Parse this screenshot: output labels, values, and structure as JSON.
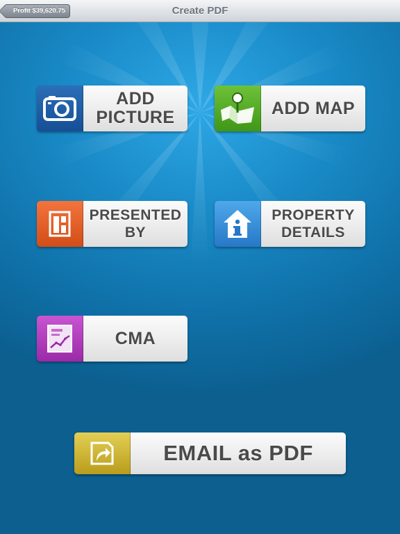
{
  "navbar": {
    "title": "Create PDF",
    "back_label": "Profit $39,620.75"
  },
  "tiles": {
    "add_picture": {
      "label": "ADD\nPICTURE",
      "icon": "camera-icon",
      "color": "#1d5fa8"
    },
    "add_map": {
      "label": "ADD MAP",
      "icon": "map-pin-icon",
      "color": "#52aa24"
    },
    "presented_by": {
      "label": "PRESENTED\nBY",
      "icon": "agent-card-icon",
      "color": "#e35f27"
    },
    "property_details": {
      "label": "PROPERTY\nDETAILS",
      "icon": "house-info-icon",
      "color": "#3a92dc"
    },
    "cma": {
      "label": "CMA",
      "icon": "chart-document-icon",
      "color": "#b23fbd"
    },
    "email_pdf": {
      "label": "EMAIL as PDF",
      "icon": "share-arrow-icon",
      "color": "#cdb634"
    }
  },
  "colors": {
    "background": "#127bb8",
    "navbar": "#dfe2e6",
    "tile_label_text": "#4a4a4a"
  }
}
